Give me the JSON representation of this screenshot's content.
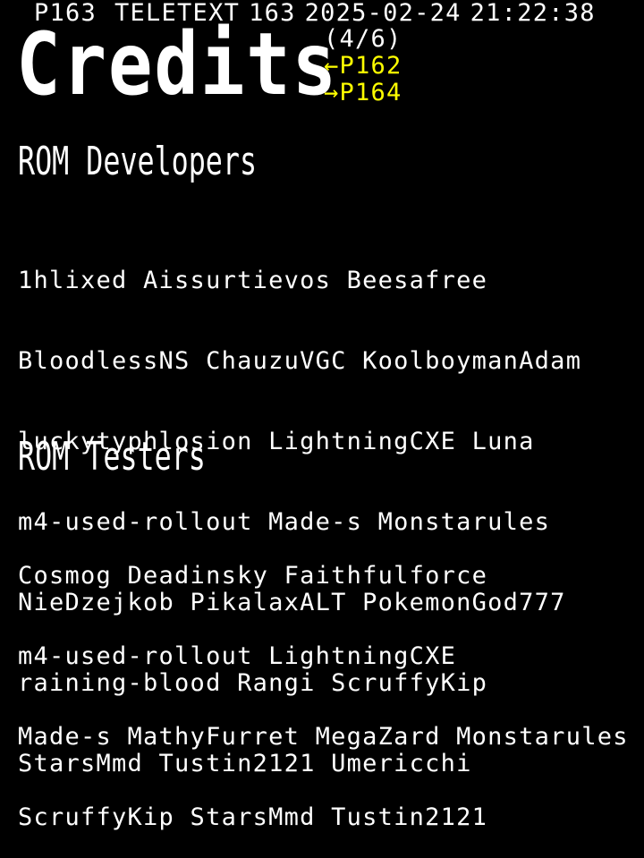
{
  "header": {
    "page_id": "P163",
    "service": "TELETEXT",
    "page_number": "163",
    "date": "2025-02-24",
    "time": "21:22:38"
  },
  "title": "Credits",
  "page_index": "(4/6)",
  "nav": {
    "prev_label": "←P162",
    "next_label": "→P164"
  },
  "colors": {
    "background": "#000000",
    "text": "#ffffff",
    "link": "#ffff00"
  },
  "sections": {
    "developers": {
      "heading": "ROM Developers",
      "lines": [
        "1hlixed Aissurtievos Beesafree",
        "BloodlessNS ChauzuVGC KoolboymanAdam",
        "luckytyphlosion LightningCXE Luna",
        "m4-used-rollout Made-s Monstarules",
        "NieDzejkob PikalaxALT PokemonGod777",
        "raining-blood Rangi ScruffyKip",
        "StarsMmd Tustin2121 Umericchi"
      ]
    },
    "testers": {
      "heading": "ROM Testers",
      "lines": [
        "Cosmog Deadinsky Faithfulforce",
        "m4-used-rollout LightningCXE",
        "Made-s MathyFurret MegaZard Monstarules",
        "ScruffyKip StarsMmd Tustin2121"
      ]
    }
  }
}
